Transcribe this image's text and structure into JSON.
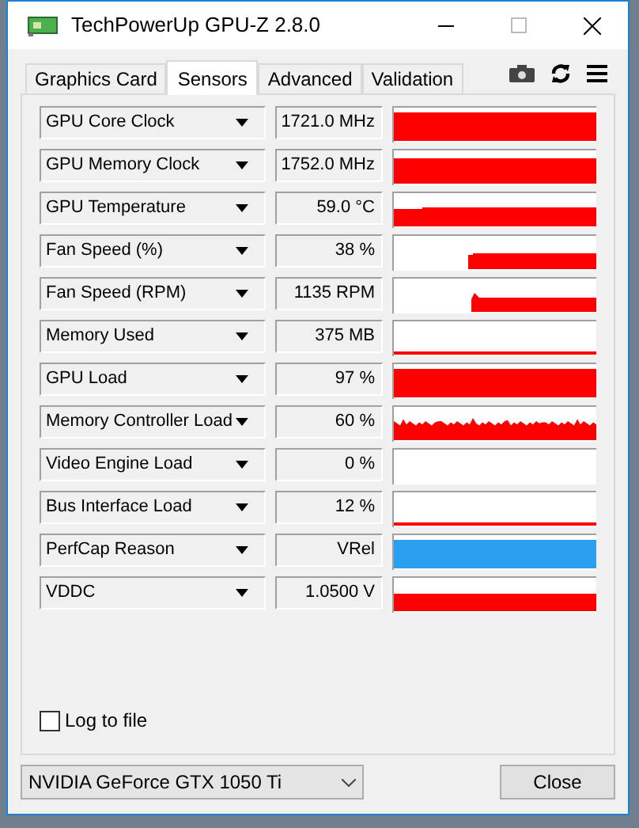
{
  "window": {
    "title": "TechPowerUp GPU-Z 2.8.0"
  },
  "tabs": [
    {
      "label": "Graphics Card",
      "selected": false
    },
    {
      "label": "Sensors",
      "selected": true
    },
    {
      "label": "Advanced",
      "selected": false
    },
    {
      "label": "Validation",
      "selected": false
    }
  ],
  "sensors": [
    {
      "name": "GPU Core Clock",
      "value": "1721.0 MHz",
      "graph": {
        "kind": "full",
        "color": "#ff0000"
      }
    },
    {
      "name": "GPU Memory Clock",
      "value": "1752.0 MHz",
      "graph": {
        "kind": "high",
        "color": "#ff0000"
      }
    },
    {
      "name": "GPU Temperature",
      "value": "59.0 °C",
      "graph": {
        "kind": "rise",
        "color": "#ff0000"
      }
    },
    {
      "name": "Fan Speed (%)",
      "value": "38 %",
      "graph": {
        "kind": "late",
        "color": "#ff0000"
      }
    },
    {
      "name": "Fan Speed (RPM)",
      "value": "1135 RPM",
      "graph": {
        "kind": "late-spike",
        "color": "#ff0000"
      }
    },
    {
      "name": "Memory Used",
      "value": "375 MB",
      "graph": {
        "kind": "thin",
        "color": "#ff0000"
      }
    },
    {
      "name": "GPU Load",
      "value": "97 %",
      "graph": {
        "kind": "full",
        "color": "#ff0000"
      }
    },
    {
      "name": "Memory Controller Load",
      "value": "60 %",
      "graph": {
        "kind": "noisy",
        "color": "#ff0000"
      }
    },
    {
      "name": "Video Engine Load",
      "value": "0 %",
      "graph": {
        "kind": "empty"
      }
    },
    {
      "name": "Bus Interface Load",
      "value": "12 %",
      "graph": {
        "kind": "thin",
        "color": "#ff0000"
      }
    },
    {
      "name": "PerfCap Reason",
      "value": "VRel",
      "graph": {
        "kind": "full",
        "color": "#2ba0f0"
      }
    },
    {
      "name": "VDDC",
      "value": "1.0500 V",
      "graph": {
        "kind": "low",
        "color": "#ff0000"
      }
    }
  ],
  "log_to_file": {
    "label": "Log to file",
    "checked": false
  },
  "device": {
    "value": "NVIDIA GeForce GTX 1050 Ti"
  },
  "buttons": [
    {
      "label": "Close"
    }
  ]
}
